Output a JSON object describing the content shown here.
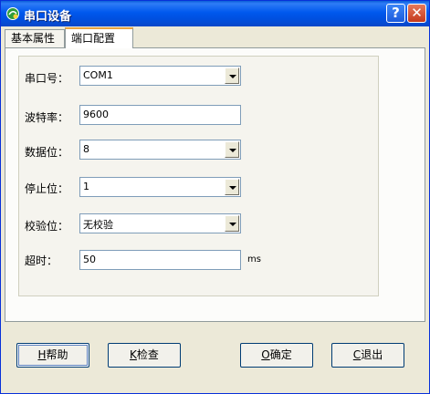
{
  "window": {
    "title": "串口设备",
    "help_glyph": "?",
    "close_glyph": "✕"
  },
  "tabs": [
    {
      "label": "基本属性",
      "active": false
    },
    {
      "label": "端口配置",
      "active": true
    }
  ],
  "fields": {
    "port": {
      "label": "串口号：",
      "value": "COM1"
    },
    "baud": {
      "label": "波特率：",
      "value": "9600"
    },
    "databits": {
      "label": "数据位：",
      "value": "8"
    },
    "stopbits": {
      "label": "停止位：",
      "value": "1"
    },
    "parity": {
      "label": "校验位：",
      "value": "无校验"
    },
    "timeout": {
      "label": "超时：",
      "value": "50",
      "unit": "ms"
    }
  },
  "buttons": {
    "help": {
      "key": "H",
      "label": "帮助"
    },
    "check": {
      "key": "K",
      "label": "检查"
    },
    "ok": {
      "key": "O",
      "label": "确定"
    },
    "exit": {
      "key": "C",
      "label": "退出"
    }
  }
}
